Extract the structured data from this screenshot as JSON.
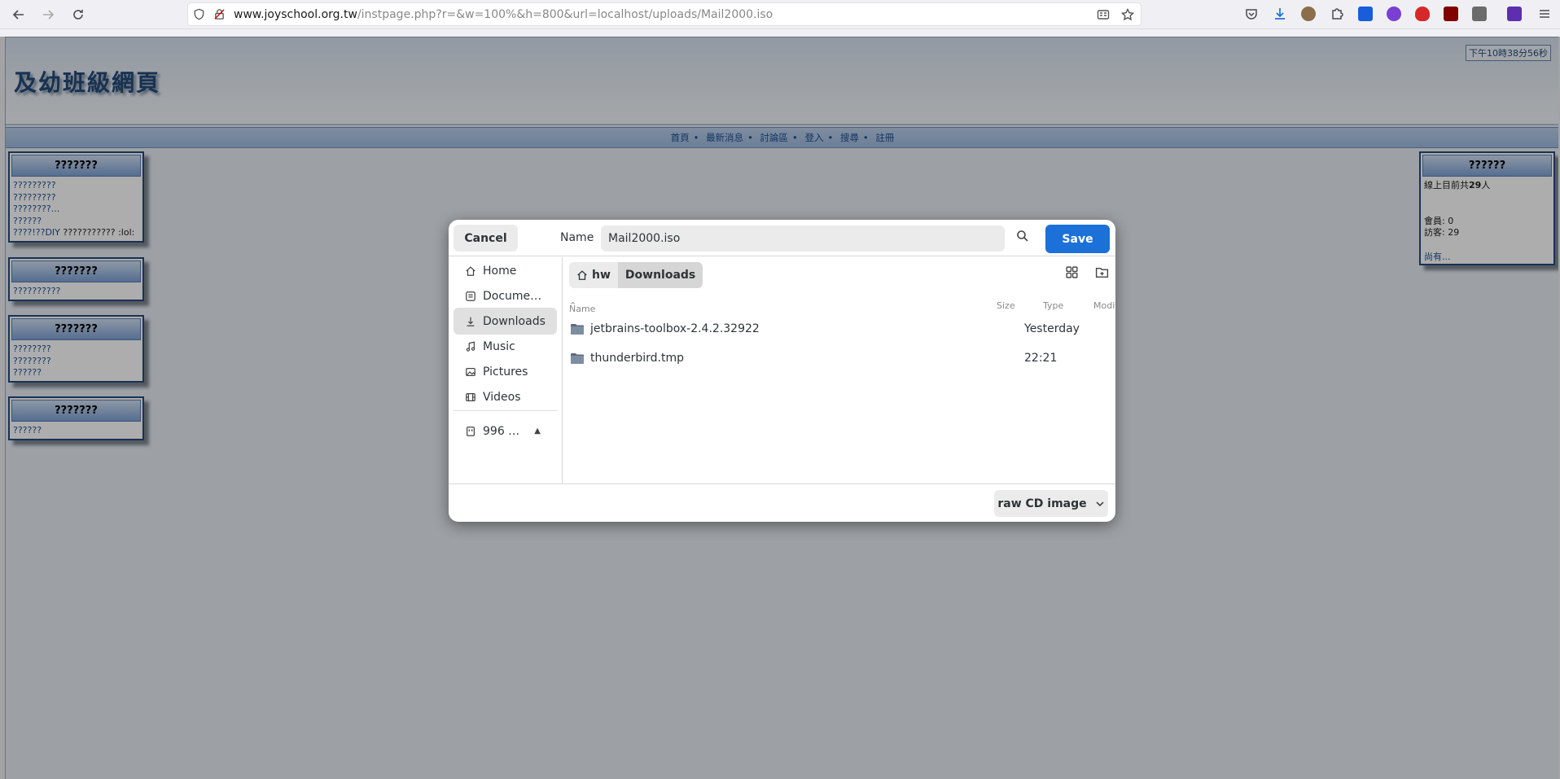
{
  "browser": {
    "url_host": "www.joyschool.org.tw",
    "url_path": "/instpage.php?r=&w=100%&h=800&url=localhost/uploads/Mail2000.iso"
  },
  "page": {
    "site_title": "及幼班級網頁",
    "clock": "下午10時38分56秒",
    "nav": [
      "首頁",
      "最新消息",
      "討論區",
      "登入",
      "搜尋",
      "註冊"
    ],
    "left_boxes": [
      {
        "title": "???????",
        "lines": [
          "?????????",
          "?????????",
          "????????...",
          "??????",
          "????!??DIY"
        ],
        "tail": " ??????????? :lol:"
      },
      {
        "title": "???????",
        "lines": [
          "??????????"
        ],
        "tail": ""
      },
      {
        "title": "???????",
        "lines": [
          "????????",
          "????????",
          "??????"
        ],
        "tail": ""
      },
      {
        "title": "???????",
        "lines": [
          "??????"
        ],
        "tail": ""
      }
    ],
    "right_box": {
      "title": "??????",
      "online_prefix": "線上目前共",
      "online_count": "29",
      "online_suffix": "人",
      "members": "會員: 0",
      "guests": "訪客: 29",
      "more": "尚有..."
    }
  },
  "dialog": {
    "cancel_label": "Cancel",
    "name_label": "Name",
    "name_value": "Mail2000.iso",
    "save_label": "Save",
    "sidebar": [
      "Home",
      "Docume…",
      "Downloads",
      "Music",
      "Pictures",
      "Videos"
    ],
    "sidebar_device": "996 …",
    "sidebar_active": "Downloads",
    "path": [
      "hw",
      "Downloads"
    ],
    "columns": {
      "name": "Name",
      "size": "Size",
      "type": "Type",
      "modified": "Modified"
    },
    "files": [
      {
        "name": "jetbrains-toolbox-2.4.2.32922",
        "modified": "Yesterday"
      },
      {
        "name": "thunderbird.tmp",
        "modified": "22:21"
      }
    ],
    "filter": "raw CD image"
  }
}
